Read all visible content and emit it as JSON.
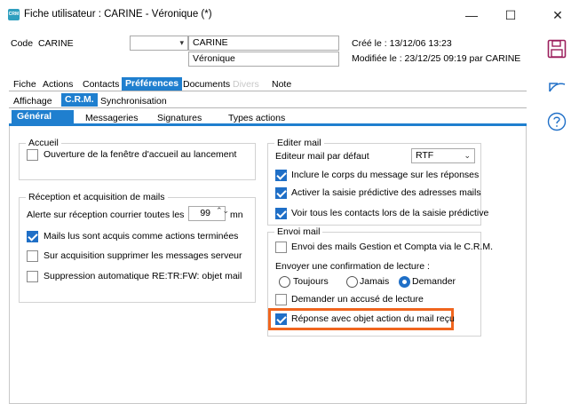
{
  "window": {
    "title": "Fiche utilisateur : CARINE - Véronique (*)",
    "app_icon_text": "CRM",
    "minimize_glyph": "—",
    "maximize_glyph": "☐",
    "close_glyph": "✕"
  },
  "header": {
    "code_label": "Code",
    "code_value": "CARINE",
    "name_value": "CARINE",
    "firstname_value": "Véronique",
    "combo_value": "",
    "created": "Créé le : 13/12/06 13:23",
    "modified": "Modifiée le : 23/12/25 09:19 par CARINE"
  },
  "main_tabs": [
    {
      "label": "Fiche"
    },
    {
      "label": "Actions"
    },
    {
      "label": "Contacts"
    },
    {
      "label": "Préférences"
    },
    {
      "label": "Documents"
    },
    {
      "label": "Divers"
    },
    {
      "label": "Note"
    }
  ],
  "sub_tabs": [
    {
      "label": "Affichage"
    },
    {
      "label": "C.R.M."
    },
    {
      "label": "Synchronisation"
    }
  ],
  "crm_tabs": [
    {
      "label": "Général"
    },
    {
      "label": "Messageries"
    },
    {
      "label": "Signatures"
    },
    {
      "label": "Types actions"
    }
  ],
  "accueil": {
    "title": "Accueil",
    "open_on_launch": {
      "label": "Ouverture de la fenêtre d'accueil au lancement",
      "checked": false
    }
  },
  "reception": {
    "title": "Réception et acquisition de mails",
    "alert_label": "Alerte sur réception courrier toutes les",
    "alert_value": "99",
    "alert_unit": "mn",
    "acquired_as_done": {
      "label": "Mails lus sont acquis comme actions terminées",
      "checked": true
    },
    "delete_server": {
      "label": "Sur acquisition supprimer les messages serveur",
      "checked": false
    },
    "auto_strip": {
      "label": "Suppression automatique RE:TR:FW: objet mail",
      "checked": false
    }
  },
  "editer_mail": {
    "title": "Editer mail",
    "editor_label": "Editeur mail par défaut",
    "editor_value": "RTF",
    "include_body": {
      "label": "Inclure le corps du message sur les réponses",
      "checked": true
    },
    "predictive": {
      "label": "Activer la saisie prédictive des adresses mails",
      "checked": true
    },
    "all_contacts": {
      "label": "Voir tous les contacts lors de la saisie prédictive",
      "checked": true
    }
  },
  "envoi_mail": {
    "title": "Envoi mail",
    "send_via_crm": {
      "label": "Envoi des mails Gestion et Compta via le C.R.M.",
      "checked": false
    },
    "read_receipt_label": "Envoyer une confirmation de lecture :",
    "radio_always": {
      "label": "Toujours",
      "selected": false
    },
    "radio_never": {
      "label": "Jamais",
      "selected": false
    },
    "radio_ask": {
      "label": "Demander",
      "selected": true
    },
    "delivery_receipt": {
      "label": "Demander un accusé de lecture",
      "checked": false
    },
    "reply_subject": {
      "label": "Réponse avec objet action du mail reçu",
      "checked": true
    }
  },
  "colors": {
    "accent": "#1f7fcf",
    "highlight": "#f0651e"
  },
  "icons": {
    "save": "save-icon",
    "undo": "undo-icon",
    "help": "help-icon"
  }
}
